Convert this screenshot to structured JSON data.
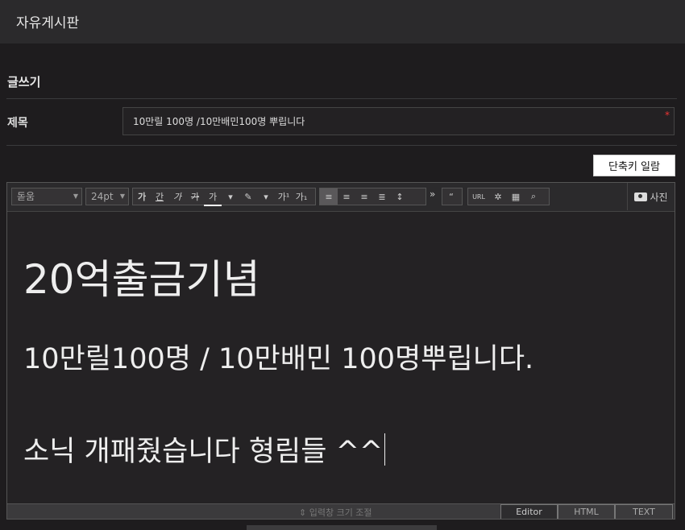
{
  "header": {
    "title": "자유게시판"
  },
  "section": {
    "title": "글쓰기"
  },
  "subject": {
    "label": "제목",
    "value": "10만릴 100명 /10만배민100명 뿌립니다",
    "required_mark": "*"
  },
  "shortcut_button": "단축키 일람",
  "toolbar": {
    "font": "돋움",
    "size": "24pt",
    "text_buttons": [
      "가",
      "간",
      "가",
      "가",
      "가"
    ],
    "super": "가¹",
    "sub": "가₁",
    "more": "»",
    "quote": "“",
    "url": "URL",
    "photo": "사진"
  },
  "content": {
    "line1": "20억출금기념",
    "line2": "10만릴100명 / 10만배민 100명뿌립니다.",
    "line3": "소닉 개패줬습니다 형림들 ^^"
  },
  "bottom": {
    "resize_label": "⇕ 입력창 크기 조절",
    "tabs": [
      "Editor",
      "HTML",
      "TEXT"
    ]
  }
}
